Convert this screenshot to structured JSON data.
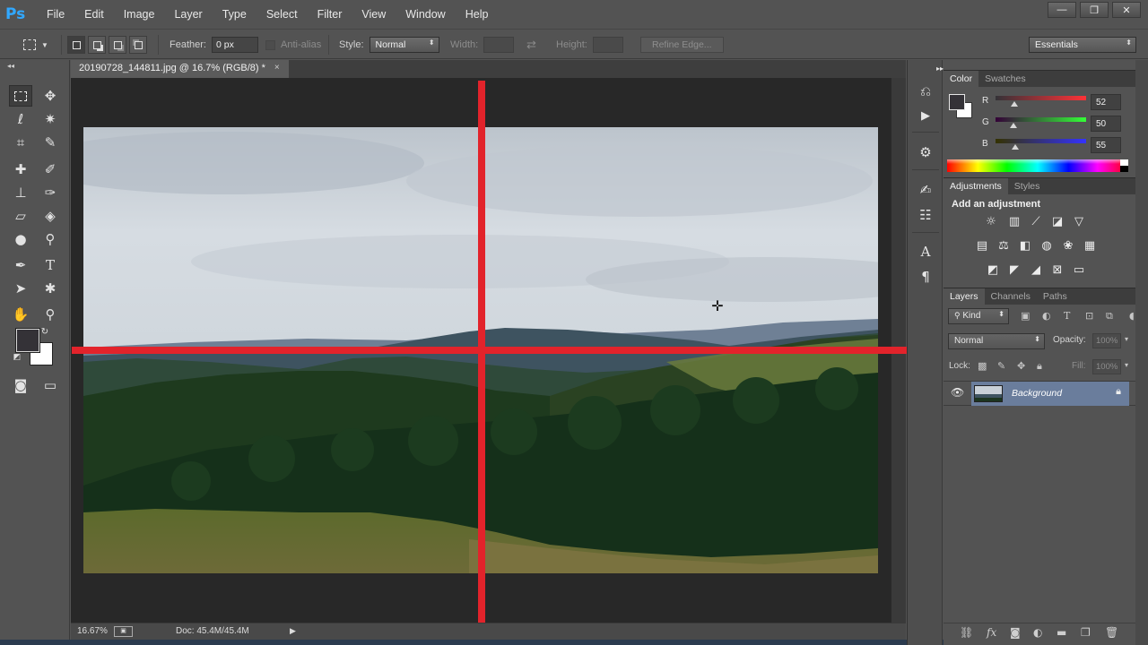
{
  "app": {
    "logo": "Ps"
  },
  "menu": [
    "File",
    "Edit",
    "Image",
    "Layer",
    "Type",
    "Select",
    "Filter",
    "View",
    "Window",
    "Help"
  ],
  "window_controls": {
    "minimize": "—",
    "restore": "❐",
    "close": "✕"
  },
  "options": {
    "feather_label": "Feather:",
    "feather_value": "0 px",
    "antialias_label": "Anti-alias",
    "style_label": "Style:",
    "style_value": "Normal",
    "width_label": "Width:",
    "height_label": "Height:",
    "refine_edge": "Refine Edge...",
    "workspace": "Essentials"
  },
  "document": {
    "tab_title": "20190728_144811.jpg @ 16.7% (RGB/8) *",
    "close": "×",
    "zoom": "16.67%",
    "doc_size": "Doc: 45.4M/45.4M"
  },
  "colors": {
    "foreground": "#343237",
    "background": "#ffffff",
    "guide": "#e2232b",
    "layer_selected": "#6a7d9c"
  },
  "color_panel": {
    "tabs": [
      "Color",
      "Swatches"
    ],
    "channels": [
      {
        "label": "R",
        "value": "52",
        "fraction": 0.204
      },
      {
        "label": "G",
        "value": "50",
        "fraction": 0.196
      },
      {
        "label": "B",
        "value": "55",
        "fraction": 0.216
      }
    ]
  },
  "adjustments_panel": {
    "tabs": [
      "Adjustments",
      "Styles"
    ],
    "title": "Add an adjustment",
    "icons": [
      [
        "brightness-contrast-icon",
        "levels-icon",
        "curves-icon",
        "exposure-icon",
        "vibrance-icon"
      ],
      [
        "hue-saturation-icon",
        "color-balance-icon",
        "black-white-icon",
        "photo-filter-icon",
        "channel-mixer-icon",
        "color-lookup-icon"
      ],
      [
        "invert-icon",
        "posterize-icon",
        "threshold-icon",
        "selective-color-icon",
        "gradient-map-icon"
      ]
    ]
  },
  "layers_panel": {
    "tabs": [
      "Layers",
      "Channels",
      "Paths"
    ],
    "filter_kind": "Kind",
    "blend_mode": "Normal",
    "opacity_label": "Opacity:",
    "opacity_value": "100%",
    "lock_label": "Lock:",
    "fill_label": "Fill:",
    "fill_value": "100%",
    "layers": [
      {
        "name": "Background",
        "visible": true,
        "locked": true
      }
    ]
  }
}
